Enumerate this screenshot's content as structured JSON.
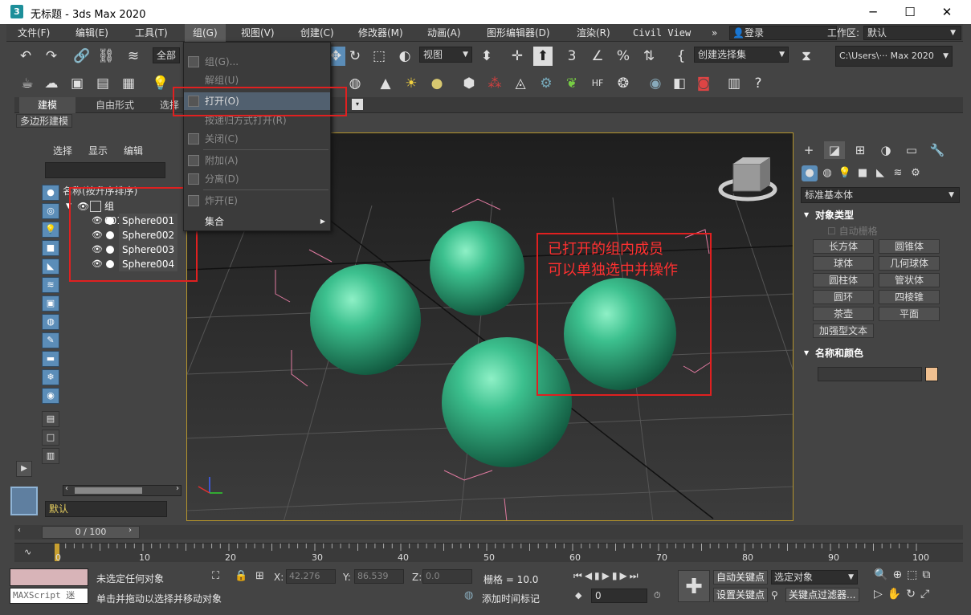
{
  "window": {
    "title": "无标题 - 3ds Max 2020",
    "app_icon": "3",
    "minimize": "─",
    "maximize": "☐",
    "close": "✕"
  },
  "menubar": {
    "items": [
      "文件(F)",
      "编辑(E)",
      "工具(T)",
      "组(G)",
      "视图(V)",
      "创建(C)",
      "修改器(M)",
      "动画(A)",
      "图形编辑器(D)",
      "渲染(R)",
      "Civil View"
    ],
    "more": "»",
    "login": "登录",
    "workspace_label": "工作区:",
    "workspace_value": "默认"
  },
  "toolbar": {
    "selection_filter": "全部",
    "ref_coord": "视图",
    "named_sel": "创建选择集",
    "path": "C:\\Users\\··· Max 2020"
  },
  "ribbon": {
    "tabs": [
      "建模",
      "自由形式",
      "选择"
    ],
    "sub_label": "多边形建模"
  },
  "group_menu": {
    "items": [
      {
        "label": "组(G)...",
        "enabled": false
      },
      {
        "label": "解组(U)",
        "enabled": false
      },
      {
        "label": "打开(O)",
        "enabled": false,
        "highlighted": true
      },
      {
        "label": "按递归方式打开(R)",
        "enabled": false
      },
      {
        "label": "关闭(C)",
        "enabled": false
      },
      {
        "label": "附加(A)",
        "enabled": false
      },
      {
        "label": "分离(D)",
        "enabled": false
      },
      {
        "label": "炸开(E)",
        "enabled": false
      },
      {
        "label": "集合",
        "enabled": true,
        "submenu": true
      }
    ]
  },
  "explorer": {
    "tabs": [
      "选择",
      "显示",
      "编辑"
    ],
    "column_header": "名称(按升序排序)",
    "group_name": "组001",
    "children": [
      "Sphere001",
      "Sphere002",
      "Sphere003",
      "Sphere004"
    ],
    "layer": "默认"
  },
  "annotation": {
    "line1": "已打开的组内成员",
    "line2": "可以单独选中并操作"
  },
  "command_panel": {
    "category": "标准基本体",
    "rollout_object_type": "对象类型",
    "autogrid": "自动栅格",
    "buttons": [
      "长方体",
      "圆锥体",
      "球体",
      "几何球体",
      "圆柱体",
      "管状体",
      "圆环",
      "四棱锥",
      "茶壶",
      "平面",
      "加强型文本"
    ],
    "rollout_name_color": "名称和颜色",
    "color_swatch": "#f0c090"
  },
  "timeline": {
    "frame_display": "0 / 100",
    "ticks": [
      "0",
      "10",
      "20",
      "30",
      "40",
      "50",
      "60",
      "70",
      "80",
      "90",
      "100"
    ]
  },
  "status": {
    "maxscript": "MAXScript 迷",
    "selection_msg": "未选定任何对象",
    "prompt": "单击并拖动以选择并移动对象",
    "x_label": "X:",
    "x_value": "42.276",
    "y_label": "Y:",
    "y_value": "86.539",
    "z_label": "Z:",
    "z_value": "0.0",
    "grid": "栅格 = 10.0",
    "add_time_tag": "添加时间标记",
    "auto_key": "自动关键点",
    "set_key": "设置关键点",
    "selected_object": "选定对象",
    "key_filters": "关键点过滤器...",
    "frame_spinner": "0"
  },
  "colors": {
    "sphere": "#3cc08e",
    "highlight_box": "#e02020",
    "viewport_border": "#b4942c"
  }
}
